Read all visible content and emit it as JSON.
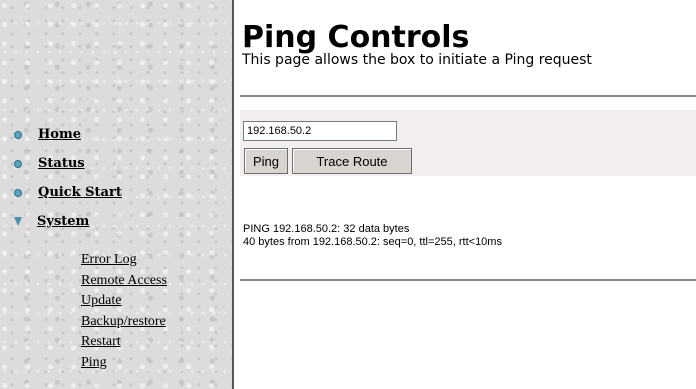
{
  "page": {
    "title": "Ping Controls",
    "subtitle": "This page allows the box to initiate a Ping request"
  },
  "nav": {
    "items": [
      {
        "label": "Home",
        "icon": "circle-bullet-icon"
      },
      {
        "label": "Status",
        "icon": "circle-bullet-icon"
      },
      {
        "label": "Quick Start",
        "icon": "circle-bullet-icon"
      },
      {
        "label": "System",
        "icon": "triangle-down-icon"
      }
    ],
    "system_subitems": [
      "Error Log",
      "Remote Access",
      "Update",
      "Backup/restore",
      "Restart",
      "Ping"
    ]
  },
  "form": {
    "ip_value": "192.168.50.2",
    "ping_label": "Ping",
    "trace_label": "Trace Route"
  },
  "output": {
    "line1": "PING 192.168.50.2: 32 data bytes",
    "line2": "40 bytes from 192.168.50.2: seq=0, ttl=255, rtt<10ms"
  },
  "colors": {
    "bullet": "#5aa6c0",
    "panel": "#f2eeee",
    "rule": "#8a8a8a"
  }
}
